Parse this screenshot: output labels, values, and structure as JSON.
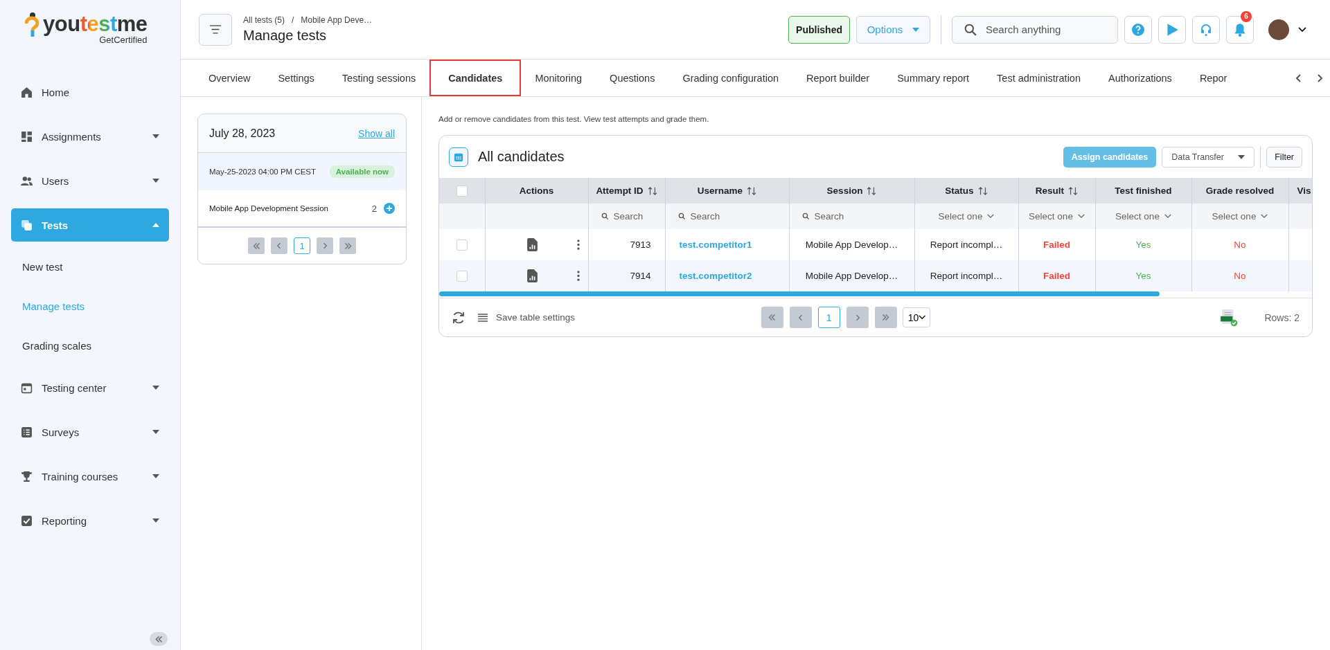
{
  "logo": {
    "wordmark": [
      "you",
      "test",
      "me"
    ],
    "tagline": "GetCertified"
  },
  "sidebar": {
    "items": [
      {
        "label": "Home",
        "kind": "link",
        "selected": false
      },
      {
        "label": "Assignments",
        "kind": "group",
        "expanded": false,
        "selected": false
      },
      {
        "label": "Users",
        "kind": "group",
        "expanded": false,
        "selected": false
      },
      {
        "label": "Tests",
        "kind": "group",
        "expanded": true,
        "selected": true,
        "children": [
          {
            "label": "New test",
            "selected": false
          },
          {
            "label": "Manage tests",
            "selected": true
          },
          {
            "label": "Grading scales",
            "selected": false
          }
        ]
      },
      {
        "label": "Testing center",
        "kind": "group",
        "expanded": false,
        "selected": false
      },
      {
        "label": "Surveys",
        "kind": "group",
        "expanded": false,
        "selected": false
      },
      {
        "label": "Training courses",
        "kind": "group",
        "expanded": false,
        "selected": false
      },
      {
        "label": "Reporting",
        "kind": "group",
        "expanded": false,
        "selected": false
      }
    ]
  },
  "header": {
    "breadcrumb": [
      "All tests (5)",
      "Mobile App Deve…"
    ],
    "breadcrumb_separator": "/",
    "title": "Manage tests",
    "status": "Published",
    "options": "Options",
    "search": {
      "placeholder": "Search anything"
    },
    "notification_count": "6"
  },
  "tabs": [
    {
      "label": "Overview",
      "selected": false
    },
    {
      "label": "Settings",
      "selected": false
    },
    {
      "label": "Testing sessions",
      "selected": false
    },
    {
      "label": "Candidates",
      "selected": true
    },
    {
      "label": "Monitoring",
      "selected": false
    },
    {
      "label": "Questions",
      "selected": false
    },
    {
      "label": "Grading configuration",
      "selected": false
    },
    {
      "label": "Report builder",
      "selected": false
    },
    {
      "label": "Summary report",
      "selected": false
    },
    {
      "label": "Test administration",
      "selected": false
    },
    {
      "label": "Authorizations",
      "selected": false
    },
    {
      "label": "Repor",
      "selected": false
    }
  ],
  "sessions_panel": {
    "date": "July 28, 2023",
    "show_all": "Show all",
    "slot": {
      "time": "May-25-2023 04:00 PM CEST",
      "badge": "Available now"
    },
    "session": {
      "name": "Mobile App Development Session",
      "count": "2"
    },
    "current_page": "1"
  },
  "candidates": {
    "description": "Add or remove candidates from this test. View test attempts and grade them.",
    "title": "All candidates",
    "assign": "Assign candidates",
    "data_transfer": "Data Transfer",
    "filter": "Filter",
    "all_checked": false,
    "columns": [
      {
        "label": "Actions",
        "sortable": false
      },
      {
        "label": "Attempt ID",
        "sortable": true,
        "filter": {
          "kind": "search",
          "placeholder": "Search"
        }
      },
      {
        "label": "Username",
        "sortable": true,
        "filter": {
          "kind": "search",
          "placeholder": "Search"
        }
      },
      {
        "label": "Session",
        "sortable": true,
        "filter": {
          "kind": "search",
          "placeholder": "Search"
        }
      },
      {
        "label": "Status",
        "sortable": true,
        "filter": {
          "kind": "select",
          "placeholder": "Select one"
        }
      },
      {
        "label": "Result",
        "sortable": true,
        "filter": {
          "kind": "select",
          "placeholder": "Select one"
        }
      },
      {
        "label": "Test finished",
        "sortable": false,
        "filter": {
          "kind": "select",
          "placeholder": "Select one"
        }
      },
      {
        "label": "Grade resolved",
        "sortable": false,
        "filter": {
          "kind": "select",
          "placeholder": "Select one"
        }
      },
      {
        "label": "Vis"
      }
    ],
    "rows": [
      {
        "checked": false,
        "attempt_id": "7913",
        "username": "test.competitor1",
        "session": "Mobile App Develop…",
        "status": "Report incompl…",
        "result": {
          "text": "Failed",
          "color": "#f44336"
        },
        "test_finished": {
          "text": "Yes",
          "color": "#4caf50"
        },
        "grade_resolved": {
          "text": "No",
          "color": "#f44336"
        }
      },
      {
        "checked": false,
        "attempt_id": "7914",
        "username": "test.competitor2",
        "session": "Mobile App Develop…",
        "status": "Report incompl…",
        "result": {
          "text": "Failed",
          "color": "#f44336"
        },
        "test_finished": {
          "text": "Yes",
          "color": "#4caf50"
        },
        "grade_resolved": {
          "text": "No",
          "color": "#f44336"
        }
      }
    ],
    "save_settings": "Save table settings",
    "current_page": "1",
    "page_size": "10",
    "rows_count": "Rows: 2"
  }
}
